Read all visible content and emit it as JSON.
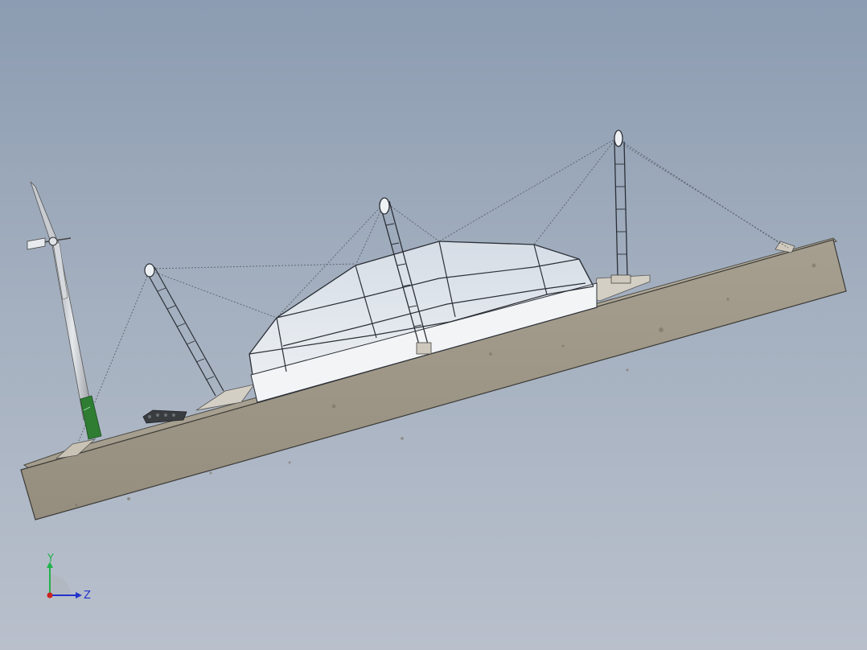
{
  "viewport": {
    "background_top": "#8c9cb1",
    "background_bottom": "#b9c0cc"
  },
  "model": {
    "parts": [
      "concrete-base-slab",
      "dome-membrane-roof",
      "left-mast",
      "center-mast",
      "right-mast",
      "wind-turbine",
      "support-cables",
      "machinery-unit"
    ],
    "colors": {
      "concrete": "#a49e8f",
      "membrane": "#e4e8ee",
      "turbine_base": "#2e7d32",
      "frame": "#2b2f36"
    }
  },
  "triad": {
    "y_label": "Y",
    "z_label": "Z",
    "y_color": "#22b14c",
    "z_color": "#2233cc",
    "x_color": "#cc2222"
  }
}
